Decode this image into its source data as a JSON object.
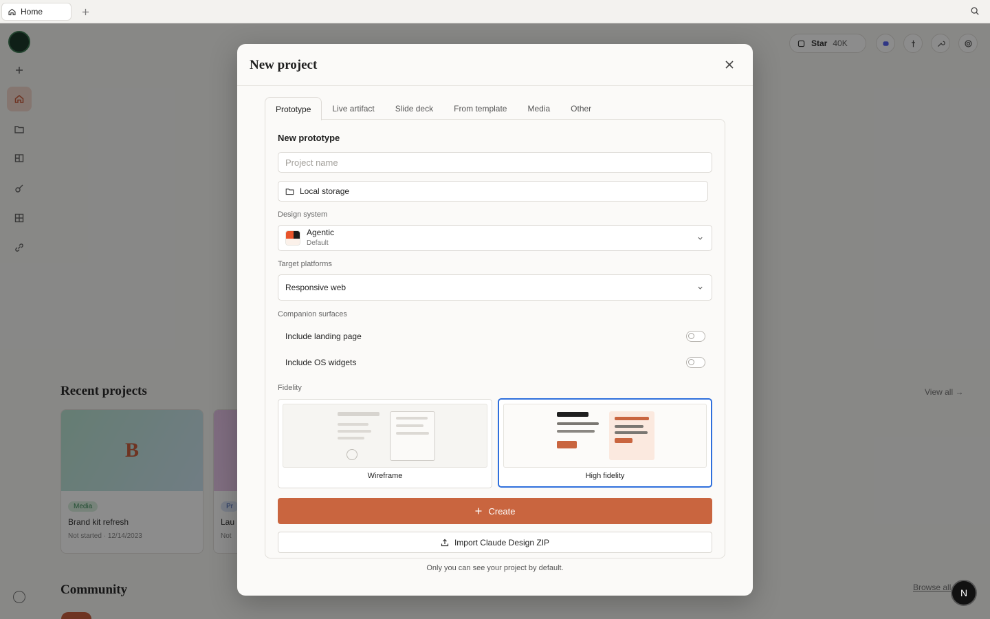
{
  "browser": {
    "tab_label": "Home"
  },
  "background": {
    "star_label": "Star",
    "star_count": "40K",
    "recent_title": "Recent projects",
    "view_all": "View all →",
    "projects": [
      {
        "thumb_letter": "B",
        "tag": "Media",
        "name": "Brand kit refresh",
        "status": "Not started",
        "date": "12/14/2023"
      },
      {
        "thumb_letter": "",
        "tag": "Pr",
        "name": "Lau",
        "status": "Not",
        "date": ""
      }
    ],
    "community_title": "Community",
    "browse_link": "Browse all"
  },
  "modal": {
    "title": "New project",
    "tabs": [
      {
        "label": "Prototype",
        "active": true
      },
      {
        "label": "Live artifact",
        "active": false
      },
      {
        "label": "Slide deck",
        "active": false
      },
      {
        "label": "From template",
        "active": false
      },
      {
        "label": "Media",
        "active": false
      },
      {
        "label": "Other",
        "active": false
      }
    ],
    "heading": "New prototype",
    "project_name": {
      "value": "",
      "placeholder": "Project name"
    },
    "storage_label": "Local storage",
    "design_system": {
      "label": "Design system",
      "name": "Agentic",
      "sub": "Default",
      "swatch_colors": [
        "#e8542b",
        "#1b1b1b",
        "#fbf1ea"
      ]
    },
    "target_platforms": {
      "label": "Target platforms",
      "value": "Responsive web"
    },
    "companion": {
      "label": "Companion surfaces",
      "toggles": [
        {
          "label": "Include landing page",
          "on": false
        },
        {
          "label": "Include OS widgets",
          "on": false
        }
      ]
    },
    "fidelity": {
      "label": "Fidelity",
      "options": [
        {
          "label": "Wireframe",
          "selected": false
        },
        {
          "label": "High fidelity",
          "selected": true
        }
      ]
    },
    "create_label": "Create",
    "import_label": "Import Claude Design ZIP",
    "privacy_note": "Only you can see your project by default."
  },
  "badge_letter": "N",
  "colors": {
    "accent": "#c9653f",
    "selected_border": "#2f6fdc",
    "overlay": "rgba(0,0,0,0.45)"
  }
}
